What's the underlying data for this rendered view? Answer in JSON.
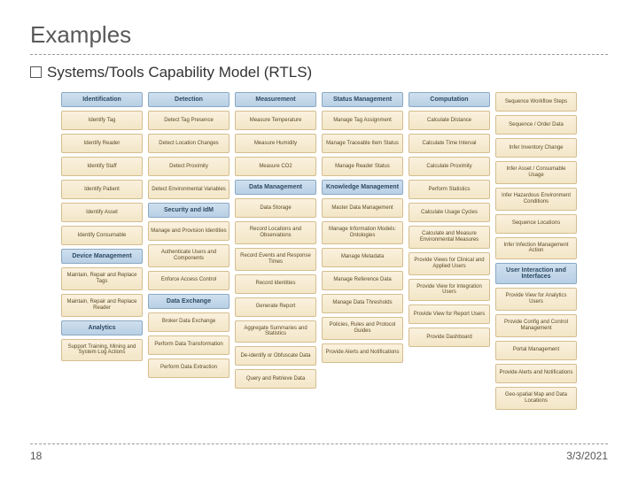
{
  "title": "Examples",
  "subtitle_prefix": "Systems/Tools",
  "subtitle_rest": "Capability Model (RTLS)",
  "page_number": "18",
  "date": "3/3/2021",
  "columns": [
    {
      "groups": [
        {
          "title": "Identification",
          "items": [
            "Identify Tag",
            "Identify Reader",
            "Identify Staff",
            "Identify Patient",
            "Identify Asset",
            "Identify Consumable"
          ]
        },
        {
          "title": "Device Management",
          "items": [
            "Maintain, Repair and Replace Tags",
            "Maintain, Repair and Replace Reader"
          ]
        },
        {
          "title": "Analytics",
          "items": [
            "Support Training, Mining and System Log Actions"
          ]
        }
      ]
    },
    {
      "groups": [
        {
          "title": "Detection",
          "items": [
            "Detect Tag Presence",
            "Detect Location Changes",
            "Detect Proximity",
            "Detect Environmental Variables"
          ]
        },
        {
          "title": "Security and IdM",
          "items": [
            "Manage and Provision Identities",
            "Authenticate Users and Components",
            "Enforce Access Control"
          ]
        },
        {
          "title": "Data Exchange",
          "items": [
            "Broker Data Exchange",
            "Perform Data Transformation",
            "Perform Data Extraction"
          ]
        }
      ]
    },
    {
      "groups": [
        {
          "title": "Measurement",
          "items": [
            "Measure Temperature",
            "Measure Humidity",
            "Measure CO2"
          ]
        },
        {
          "title": "Data Management",
          "items": [
            "Data Storage",
            "Record Locations and Observations",
            "Record Events and Response Times",
            "Record Identities",
            "Generate Report",
            "Aggregate Summaries and Statistics",
            "De-identify or Obfuscate Data",
            "Query and Retrieve Data"
          ]
        }
      ]
    },
    {
      "groups": [
        {
          "title": "Status Management",
          "items": [
            "Manage Tag Assignment",
            "Manage Traceable Item Status",
            "Manage Reader Status"
          ]
        },
        {
          "title": "Knowledge Management",
          "items": [
            "Master Data Management",
            "Manage Information Models: Ontologies",
            "Manage Metadata",
            "Manage Reference Data",
            "Manage Data Thresholds",
            "Policies, Rules and Protocol Guides",
            "Provide Alerts and Notifications"
          ]
        }
      ]
    },
    {
      "groups": [
        {
          "title": "Computation",
          "items": [
            "Calculate Distance",
            "Calculate Time Interval",
            "Calculate Proximity",
            "Perform Statistics",
            "Calculate Usage Cycles",
            "Calculate and Measure Environmental Measures"
          ]
        },
        {
          "title": "",
          "items": [
            "Provide Views for Clinical and Applied Users",
            "Provide View for Integration Users",
            "Provide View for Report Users",
            "Provide Dashboard"
          ]
        }
      ]
    },
    {
      "groups": [
        {
          "title": "",
          "items": [
            "Sequence Workflow Steps",
            "Sequence / Order Data",
            "Infer Inventory Change",
            "Infer Asset / Consumable Usage",
            "Infer Hazardous Environment Conditions",
            "Sequence Locations",
            "Infer Infection Management Action"
          ]
        },
        {
          "title": "User Interaction and Interfaces",
          "items": [
            "Provide View for Analytics Users",
            "Provide Config and Control Management",
            "Portal Management",
            "Provide Alerts and Notifications",
            "Geo-spatial Map and Data Locations"
          ]
        }
      ]
    }
  ]
}
